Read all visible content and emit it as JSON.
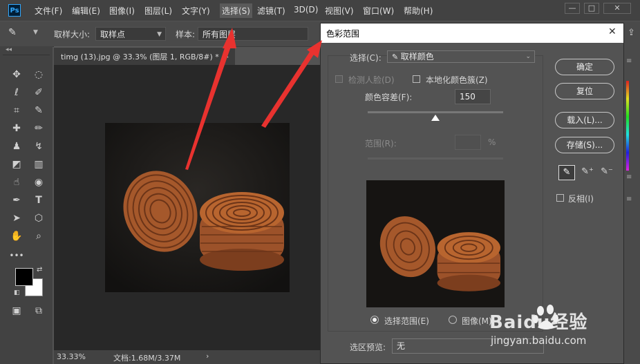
{
  "app": {
    "logo": "Ps"
  },
  "menu": [
    "文件(F)",
    "编辑(E)",
    "图像(I)",
    "图层(L)",
    "文字(Y)",
    "选择(S)",
    "滤镜(T)",
    "3D(D)",
    "视图(V)",
    "窗口(W)",
    "帮助(H)"
  ],
  "window_controls": {
    "minimize": "—",
    "maximize": "□",
    "close": "✕"
  },
  "options": {
    "sample_size_label": "取样大小:",
    "sample_size_value": "取样点",
    "sample_label": "样本:",
    "sample_value": "所有图层"
  },
  "document": {
    "tab_title": "timg (13).jpg @ 33.3% (图层 1, RGB/8#) *",
    "tab_close": "×",
    "zoom": "33.33%",
    "doc_size": "文档:1.68M/3.37M",
    "status_arrow": "›"
  },
  "dialog": {
    "title": "色彩范围",
    "select_label": "选择(C):",
    "select_value": "取样颜色",
    "detect_faces": "检测人脸(D)",
    "localized": "本地化颜色簇(Z)",
    "fuzziness_label": "颜色容差(F):",
    "fuzziness_value": "150",
    "fuzziness_level": 0.5,
    "range_label": "范围(R):",
    "range_value": "",
    "range_unit": "%",
    "radio_selection": "选择范围(E)",
    "radio_image": "图像(M)",
    "preview_label": "选区预览:",
    "preview_value": "无",
    "btn_ok": "确定",
    "btn_reset": "复位",
    "btn_load": "载入(L)...",
    "btn_save": "存储(S)...",
    "invert": "反相(I)"
  },
  "watermark": {
    "brand": "Baidu经验",
    "url": "jingyan.baidu.com"
  },
  "colors": {
    "accent_arrow": "#e8322f",
    "foreground": "#000000",
    "background": "#ffffff"
  }
}
